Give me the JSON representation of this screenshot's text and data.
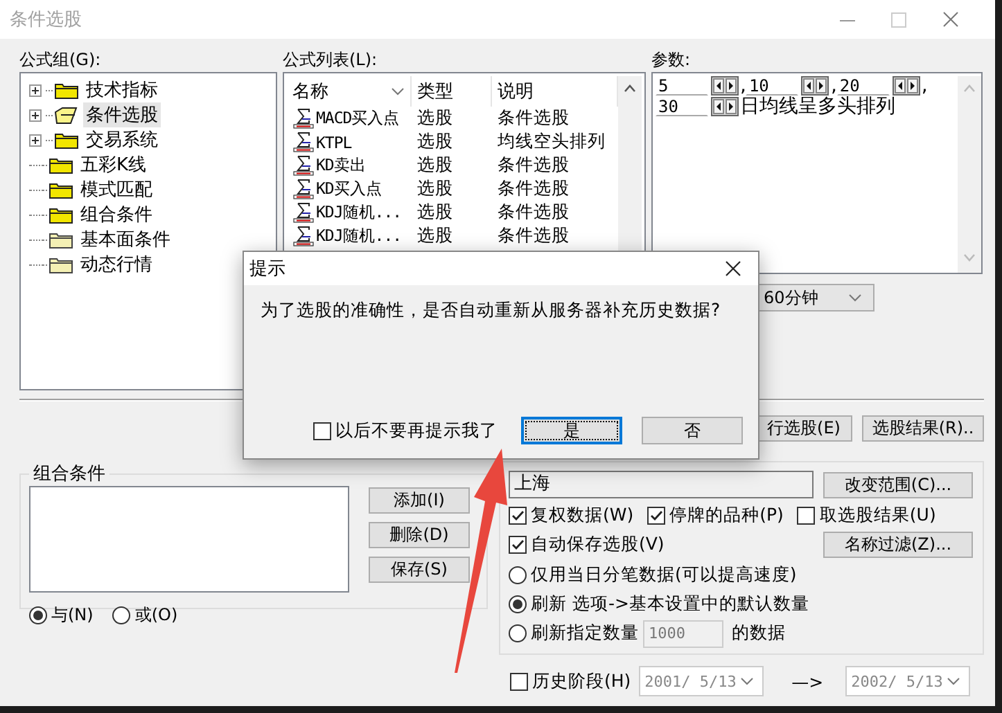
{
  "window": {
    "title": "条件选股"
  },
  "formula_groups": {
    "label": "公式组(G):",
    "items": [
      {
        "label": "技术指标",
        "kind": "folder",
        "expandable": true,
        "selected": false
      },
      {
        "label": "条件选股",
        "kind": "open-folder",
        "expandable": true,
        "selected": true
      },
      {
        "label": "交易系统",
        "kind": "folder",
        "expandable": true,
        "selected": false
      },
      {
        "label": "五彩K线",
        "kind": "folder",
        "expandable": false,
        "selected": false
      },
      {
        "label": "模式匹配",
        "kind": "folder",
        "expandable": false,
        "selected": false
      },
      {
        "label": "组合条件",
        "kind": "folder",
        "expandable": false,
        "selected": false
      },
      {
        "label": "基本面条件",
        "kind": "pale-folder",
        "expandable": false,
        "selected": false
      },
      {
        "label": "动态行情",
        "kind": "pale-folder",
        "expandable": false,
        "selected": false
      }
    ]
  },
  "formula_list": {
    "label": "公式列表(L):",
    "columns": [
      "名称",
      "类型",
      "说明"
    ],
    "rows": [
      {
        "name": "MACD买入点",
        "type": "选股",
        "description": "条件选股"
      },
      {
        "name": "KTPL",
        "type": "选股",
        "description": "均线空头排列"
      },
      {
        "name": "KD卖出",
        "type": "选股",
        "description": "条件选股"
      },
      {
        "name": "KD买入点",
        "type": "选股",
        "description": "条件选股"
      },
      {
        "name": "KDJ随机...",
        "type": "选股",
        "description": "条件选股"
      },
      {
        "name": "KDJ随机...",
        "type": "选股",
        "description": "条件选股"
      }
    ]
  },
  "parameters": {
    "label": "参数:",
    "segments": [
      {
        "kind": "input",
        "value": "5"
      },
      {
        "kind": "text",
        "text": ","
      },
      {
        "kind": "input",
        "value": "10"
      },
      {
        "kind": "text",
        "text": ","
      },
      {
        "kind": "input",
        "value": "20"
      },
      {
        "kind": "text",
        "text": ","
      },
      {
        "kind": "input",
        "value": "30"
      },
      {
        "kind": "text",
        "text": "日均线呈多头排列"
      }
    ]
  },
  "period": {
    "value": "60分钟"
  },
  "actions": [
    "行选股(E)",
    "选股结果(R).."
  ],
  "combine": {
    "title": "组合条件",
    "buttons": [
      "添加(I)",
      "删除(D)",
      "保存(S)"
    ],
    "options": [
      {
        "label": "与(N)",
        "selected": true
      },
      {
        "label": "或(O)",
        "selected": false
      }
    ]
  },
  "settings": {
    "market": "上海",
    "change_range": "改变范围(C)...",
    "name_filter": "名称过滤(Z)...",
    "checks": [
      {
        "label": "复权数据(W)",
        "checked": true
      },
      {
        "label": "停牌的品种(P)",
        "checked": true
      },
      {
        "label": "取选股结果(U)",
        "checked": false
      },
      {
        "label": "自动保存选股(V)",
        "checked": true
      }
    ],
    "refresh_options": [
      {
        "label": "仅用当日分笔数据(可以提高速度)",
        "selected": false
      },
      {
        "label": "刷新 选项->基本设置中的默认数量",
        "selected": true
      },
      {
        "label": "刷新指定数量",
        "selected": false,
        "count": "1000",
        "suffix": "的数据"
      }
    ]
  },
  "history": {
    "label": "历史阶段(H)",
    "checked": false,
    "from": "2001/ 5/13",
    "separator": "—>",
    "to": "2002/ 5/13",
    "dates_enabled": false
  },
  "dialog": {
    "title": "提示",
    "message": "为了选股的准确性，是否自动重新从服务器补充历史数据?",
    "dont_ask": {
      "label": "以后不要再提示我了",
      "checked": false
    },
    "buttons": [
      {
        "label": "是",
        "focused": true
      },
      {
        "label": "否",
        "focused": false
      }
    ]
  }
}
